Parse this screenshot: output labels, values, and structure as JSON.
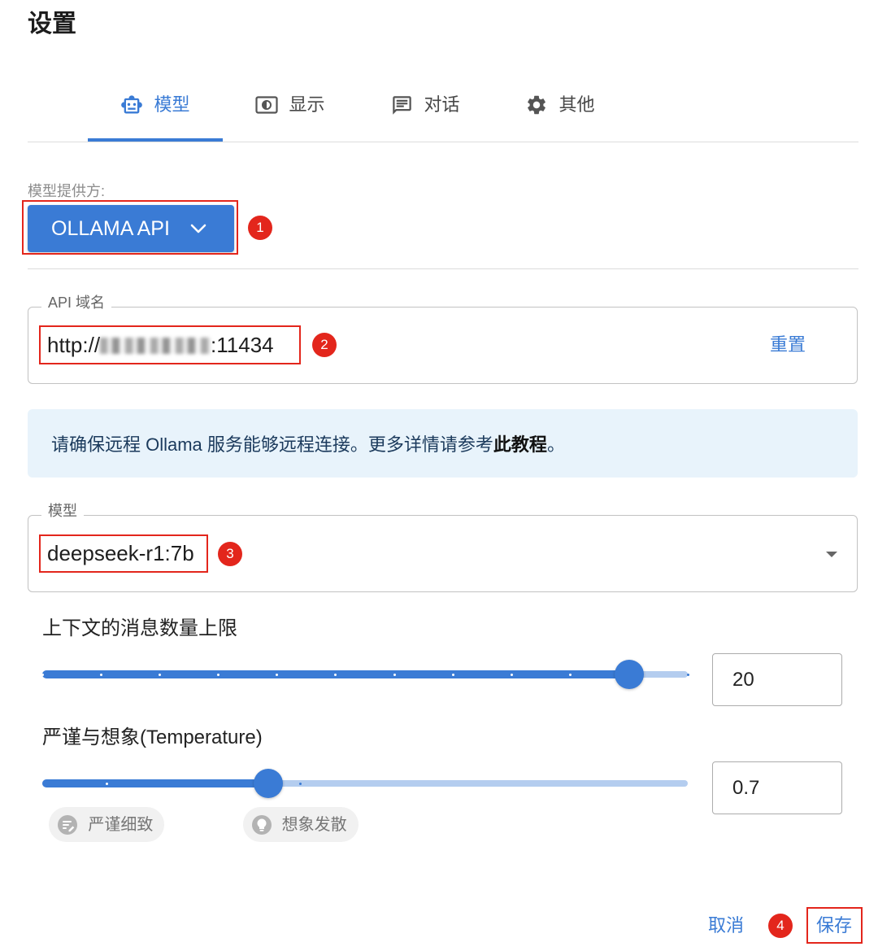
{
  "page_title": "设置",
  "tabs": [
    {
      "label": "模型",
      "icon": "robot-icon",
      "active": true
    },
    {
      "label": "显示",
      "icon": "display-icon",
      "active": false
    },
    {
      "label": "对话",
      "icon": "chat-icon",
      "active": false
    },
    {
      "label": "其他",
      "icon": "gear-icon",
      "active": false
    }
  ],
  "provider": {
    "label": "模型提供方:",
    "selected": "OLLAMA API",
    "icon": "chevron-down-icon"
  },
  "api_host": {
    "legend": "API 域名",
    "value_prefix": "http://",
    "value_suffix": ":11434",
    "reset_label": "重置"
  },
  "info": {
    "text_before": "请确保远程 Ollama 服务能够远程连接。更多详情请参考",
    "link_text": "此教程",
    "text_after": "。"
  },
  "model": {
    "legend": "模型",
    "selected": "deepseek-r1:7b",
    "icon": "dropdown-arrow-icon"
  },
  "context_limit": {
    "label": "上下文的消息数量上限",
    "value": 20,
    "min": 0,
    "max": 22,
    "step": 2
  },
  "temperature": {
    "label": "严谨与想象(Temperature)",
    "value": 0.7,
    "min": 0,
    "max": 2,
    "marks": [
      {
        "value": 0.2,
        "label": "严谨细致",
        "icon": "precise-icon"
      },
      {
        "value": 0.8,
        "label": "想象发散",
        "icon": "lightbulb-icon"
      }
    ]
  },
  "footer": {
    "cancel_label": "取消",
    "save_label": "保存"
  },
  "annotations": {
    "provider": "1",
    "api_host": "2",
    "model": "3",
    "save": "4"
  },
  "colors": {
    "accent": "#3a7bd5",
    "annotation_red": "#e3261c",
    "info_background": "#e8f3fb",
    "slider_rail": "#b4cdef"
  }
}
